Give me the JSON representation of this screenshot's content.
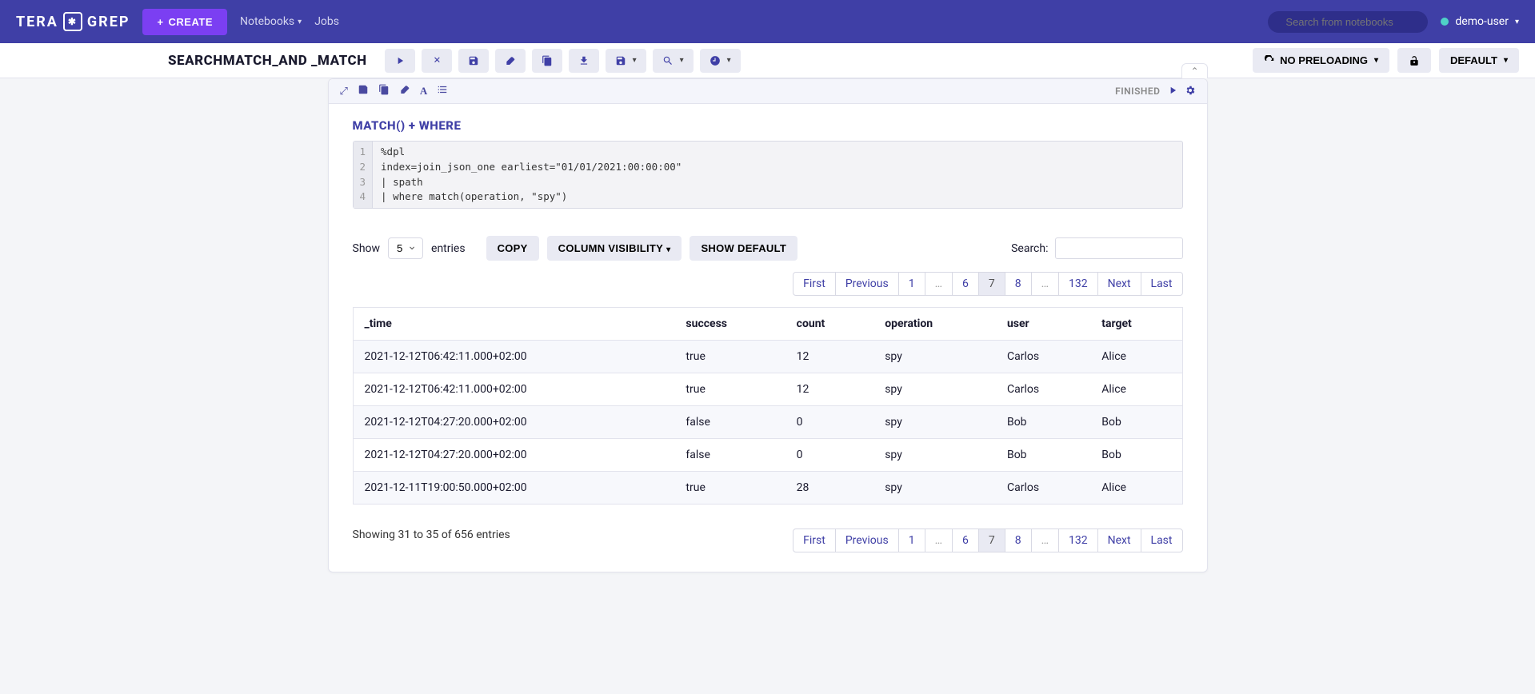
{
  "brand": {
    "part1": "TERA",
    "part2": "GREP"
  },
  "topbar": {
    "create_label": "CREATE",
    "nav": {
      "notebooks": "Notebooks",
      "jobs": "Jobs"
    },
    "search_placeholder": "Search from notebooks",
    "user": "demo-user"
  },
  "subbar": {
    "title": "SEARCHMATCH_AND _MATCH",
    "no_preloading": "NO PRELOADING",
    "default": "DEFAULT"
  },
  "cell": {
    "status": "FINISHED",
    "title": "MATCH()  +  WHERE",
    "code_lines": [
      "%dpl",
      "index=join_json_one earliest=\"01/01/2021:00:00:00\"",
      "| spath",
      "| where match(operation, \"spy\")"
    ]
  },
  "table_controls": {
    "show_label": "Show",
    "entries_label": "entries",
    "entries_value": "5",
    "copy": "COPY",
    "column_visibility": "COLUMN VISIBILITY",
    "show_default": "SHOW DEFAULT",
    "search_label": "Search:"
  },
  "pagination": {
    "first": "First",
    "previous": "Previous",
    "next": "Next",
    "last": "Last",
    "pages": [
      "1",
      "…",
      "6",
      "7",
      "8",
      "…",
      "132"
    ],
    "active": "7"
  },
  "table": {
    "headers": [
      "_time",
      "success",
      "count",
      "operation",
      "user",
      "target"
    ],
    "rows": [
      [
        "2021-12-12T06:42:11.000+02:00",
        "true",
        "12",
        "spy",
        "Carlos",
        "Alice"
      ],
      [
        "2021-12-12T06:42:11.000+02:00",
        "true",
        "12",
        "spy",
        "Carlos",
        "Alice"
      ],
      [
        "2021-12-12T04:27:20.000+02:00",
        "false",
        "0",
        "spy",
        "Bob",
        "Bob"
      ],
      [
        "2021-12-12T04:27:20.000+02:00",
        "false",
        "0",
        "spy",
        "Bob",
        "Bob"
      ],
      [
        "2021-12-11T19:00:50.000+02:00",
        "true",
        "28",
        "spy",
        "Carlos",
        "Alice"
      ]
    ]
  },
  "info": "Showing 31 to 35 of 656 entries"
}
